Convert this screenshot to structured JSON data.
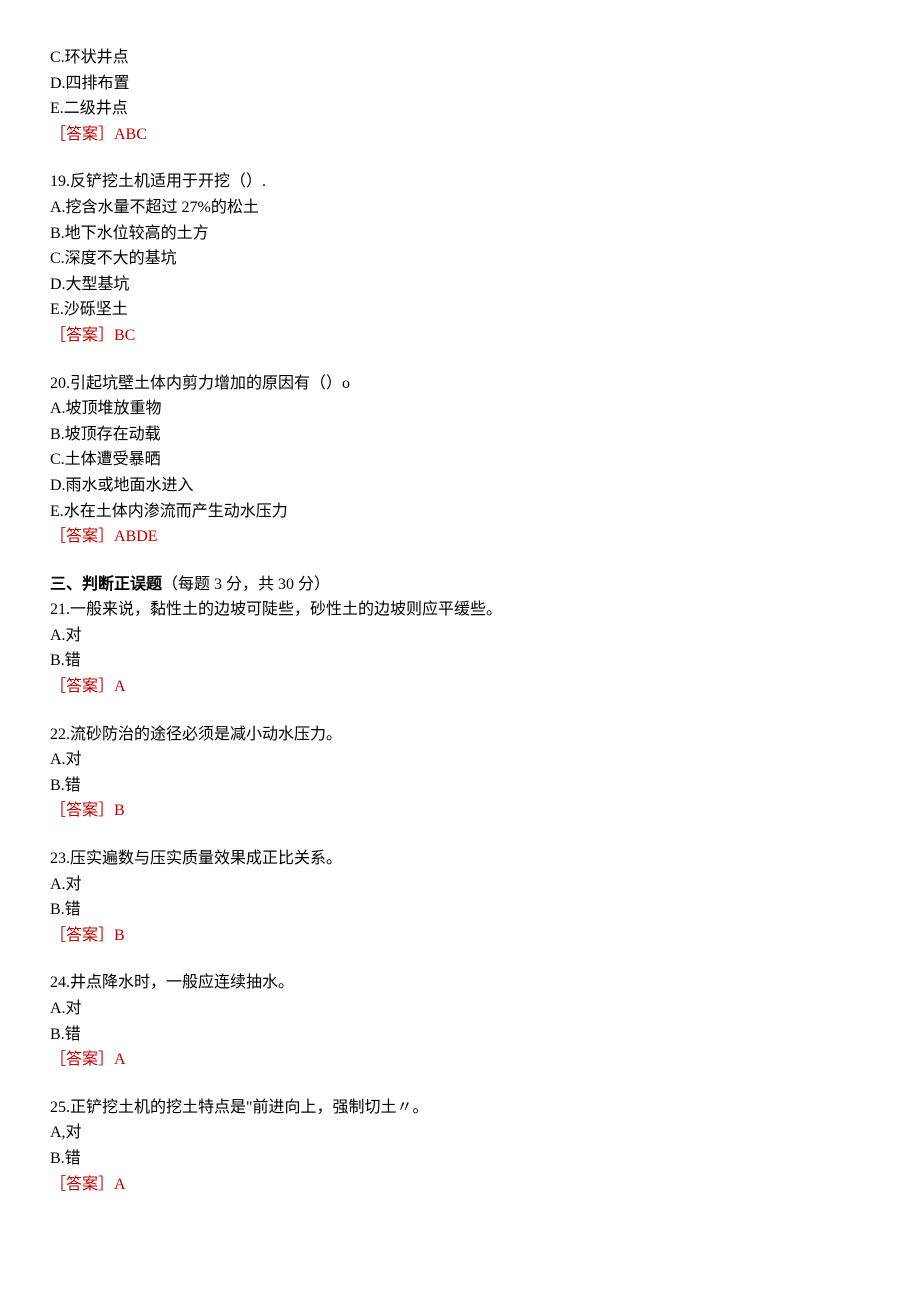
{
  "q18_partial": {
    "optC": "C.环状井点",
    "optD": "D.四排布置",
    "optE": "E.二级井点",
    "answer": "［答案］ABC"
  },
  "q19": {
    "stem": "19.反铲挖土机适用于开挖（）.",
    "optA": "A.挖含水量不超过 27%的松土",
    "optB": "B.地下水位较高的土方",
    "optC": "C.深度不大的基坑",
    "optD": "D.大型基坑",
    "optE": "E.沙砾坚土",
    "answer": "［答案］BC"
  },
  "q20": {
    "stem": "20.引起坑壁土体内剪力增加的原因有（）o",
    "optA": "A.坡顶堆放重物",
    "optB": "B.坡顶存在动载",
    "optC": "C.土体遭受暴晒",
    "optD": "D.雨水或地面水进入",
    "optE": "E.水在土体内渗流而产生动水压力",
    "answer": "［答案］ABDE"
  },
  "section3": {
    "title": "三、判断正误题",
    "info": "（每题 3 分，共 30 分）"
  },
  "q21": {
    "stem": "21.一般来说，黏性土的边坡可陡些，砂性土的边坡则应平缓些。",
    "optA": "A.对",
    "optB": "B.错",
    "answer": "［答案］A"
  },
  "q22": {
    "stem": "22.流砂防治的途径必须是减小动水压力。",
    "optA": "A.对",
    "optB": "B.错",
    "answer": "［答案］B"
  },
  "q23": {
    "stem": "23.压实遍数与压实质量效果成正比关系。",
    "optA": "A.对",
    "optB": "B.错",
    "answer": "［答案］B"
  },
  "q24": {
    "stem": "24.井点降水时，一般应连续抽水。",
    "optA": "A.对",
    "optB": "B.错",
    "answer": "［答案］A"
  },
  "q25": {
    "stem": "25.正铲挖土机的挖土特点是\"前进向上，强制切土〃。",
    "optA": "A,对",
    "optB": "B.错",
    "answer": "［答案］A"
  }
}
